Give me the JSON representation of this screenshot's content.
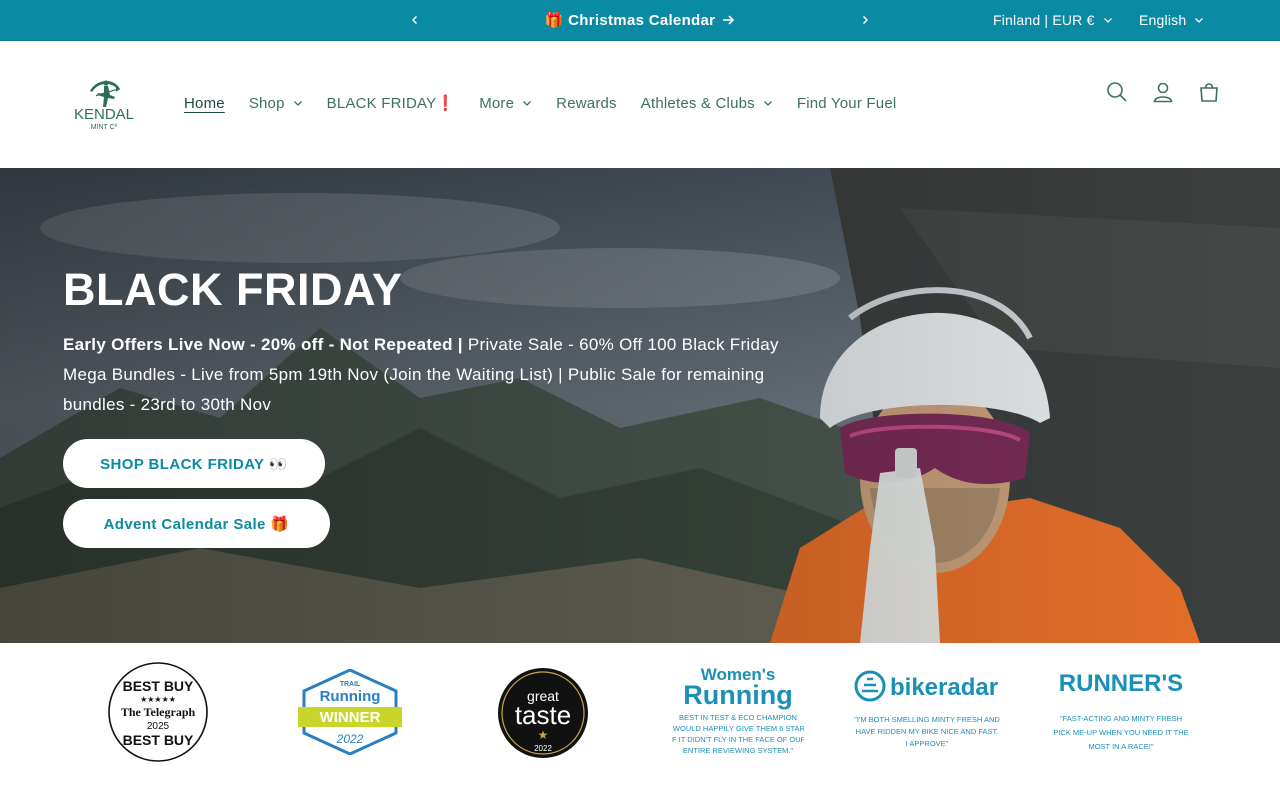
{
  "announcement": {
    "message": "🎁 Christmas Calendar",
    "country": "Finland | EUR €",
    "language": "English"
  },
  "header": {
    "logo_text": "KENDAL",
    "logo_subtext": "MINT Cº",
    "nav": [
      {
        "label": "Home"
      },
      {
        "label": "Shop"
      },
      {
        "label": "BLACK FRIDAY❗"
      },
      {
        "label": "More"
      },
      {
        "label": "Rewards"
      },
      {
        "label": "Athletes & Clubs"
      },
      {
        "label": "Find Your Fuel"
      }
    ]
  },
  "hero": {
    "title": "BLACK FRIDAY",
    "bold_intro": "Early Offers Live Now - 20% off - Not Repeated |",
    "body": " Private Sale - 60% Off 100 Black Friday Mega Bundles - Live from 5pm 19th Nov (Join the Waiting List) | Public Sale for remaining bundles - 23rd to 30th Nov",
    "button1": "SHOP BLACK FRIDAY 👀",
    "button2": "Advent Calendar Sale 🎁"
  },
  "badges": {
    "telegraph": {
      "top": "BEST BUY",
      "name": "The Telegraph",
      "year": "2025",
      "bottom": "BEST BUY"
    },
    "trail": {
      "brand": "TRAIL",
      "title": "Running",
      "award": "WINNER",
      "year": "2022"
    },
    "great_taste": {
      "line1": "great",
      "line2": "taste",
      "year": "2022"
    },
    "womens": {
      "title1": "Women's",
      "title2": "Running",
      "quote": [
        "BEST IN TEST & ECO CHAMPION",
        "\"I WOULD HAPPILY GIVE THEM 6 STARS",
        "IF IT DIDN'T FLY IN THE FACE OF OUR",
        "ENTIRE REVIEWING SYSTEM.\""
      ]
    },
    "bikeradar": {
      "title": "bikeradar",
      "quote": [
        "\"I'M BOTH SMELLING MINTY FRESH AND",
        "HAVE RIDDEN MY BIKE NICE AND FAST.",
        "I APPROVE\""
      ]
    },
    "runners": {
      "title": "RUNNER'S",
      "quote": [
        "\"FAST-ACTING AND MINTY FRESH",
        "PICK ME-UP WHEN YOU NEED IT THE",
        "MOST IN A RACE!\""
      ]
    }
  },
  "colors": {
    "brand_teal": "#0b8aa3",
    "nav_green": "#3e6f63",
    "logo_green": "#2e6e58"
  }
}
